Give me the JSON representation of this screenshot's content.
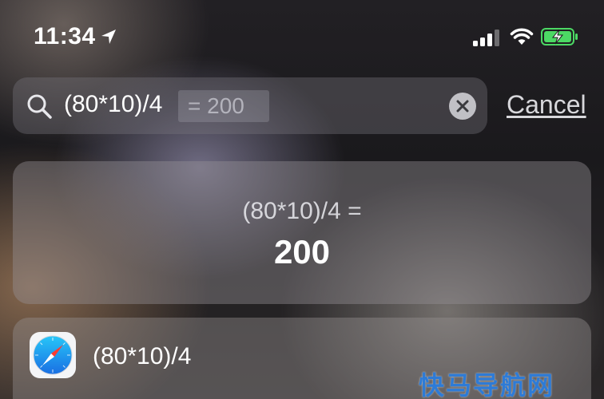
{
  "status_bar": {
    "time": "11:34",
    "icons": [
      "location-arrow-icon",
      "cellular-signal-icon",
      "wifi-icon",
      "battery-charging-icon"
    ],
    "battery_color": "#4cd964"
  },
  "search": {
    "query": "(80*10)/4",
    "inline_result": "=  200",
    "icon": "search-icon",
    "clear_icon": "clear-icon",
    "cancel_label": "Cancel"
  },
  "calculator_card": {
    "expression": "(80*10)/4 =",
    "result": "200"
  },
  "web_result": {
    "app_icon": "safari-icon",
    "label": "(80*10)/4"
  },
  "watermark": "快马导航网"
}
